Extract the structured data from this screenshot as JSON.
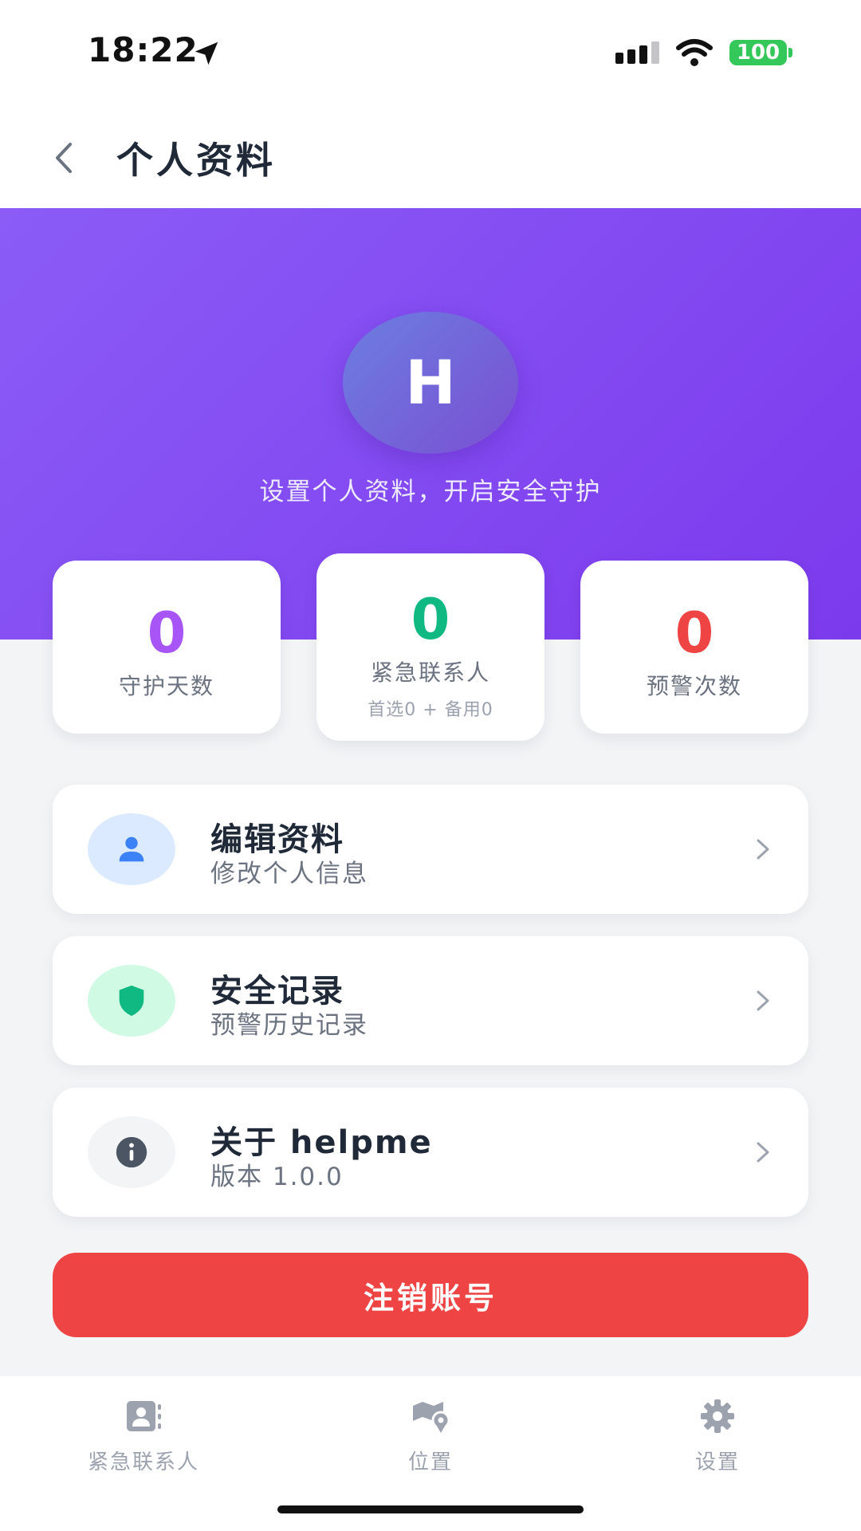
{
  "status_bar": {
    "time": "18:22",
    "battery": "100"
  },
  "header": {
    "title": "个人资料",
    "back_icon": "chevron-left-icon"
  },
  "profile": {
    "avatar_initial": "H",
    "subtitle": "设置个人资料，开启安全守护"
  },
  "stats": [
    {
      "value": "0",
      "label": "守护天数",
      "color": "#a855f7"
    },
    {
      "value": "0",
      "label": "紧急联系人",
      "sub": "首选0 + 备用0",
      "color": "#10b981"
    },
    {
      "value": "0",
      "label": "预警次数",
      "color": "#ef4444"
    }
  ],
  "menu": [
    {
      "title": "编辑资料",
      "subtitle": "修改个人信息",
      "icon": "user-icon",
      "icon_bg": "#dbeafe",
      "icon_color": "#3b82f6"
    },
    {
      "title": "安全记录",
      "subtitle": "预警历史记录",
      "icon": "shield-icon",
      "icon_bg": "#d1fae5",
      "icon_color": "#10b981"
    },
    {
      "title": "关于 helpme",
      "subtitle": "版本 1.0.0",
      "icon": "info-icon",
      "icon_bg": "#f3f4f6",
      "icon_color": "#4b5563"
    }
  ],
  "logout_label": "注销账号",
  "tabs": [
    {
      "label": "紧急联系人",
      "icon": "contacts-icon"
    },
    {
      "label": "位置",
      "icon": "map-location-icon"
    },
    {
      "label": "设置",
      "icon": "gear-icon"
    }
  ],
  "colors": {
    "hero_gradient_start": "#8b5cf6",
    "hero_gradient_end": "#7c3aed",
    "danger": "#ef4444"
  }
}
